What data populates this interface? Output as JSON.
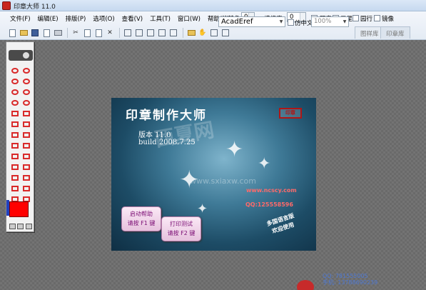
{
  "window": {
    "title": "印章大师 11.0"
  },
  "menu": [
    "文件(F)",
    "编辑(E)",
    "排版(P)",
    "选项(O)",
    "查看(V)",
    "工具(T)",
    "窗口(W)",
    "帮助(H)"
  ],
  "controls": {
    "rotation_label": "旋转角:",
    "rotation_value": "0",
    "stretch_label": "横缩度:",
    "stretch_value": "0",
    "yang_label": "阳章",
    "five_star_label": "五星",
    "circle_label": "园行",
    "mirror_label": "镜像",
    "font_value": "AcadEref",
    "fangzhong_label": "仿中文",
    "zoom_value": "100%",
    "tab_template": "图样库",
    "tab_stamp": "印章库"
  },
  "splash": {
    "title": "印章制作大师",
    "seal_text": "印章",
    "version": "版本 11.0",
    "build": "build 2008.7.25",
    "watermark_big": "西夏网",
    "watermark_url": "www.sxiaxw.com",
    "website": "www.ncscy.com",
    "qq": "QQ:125558596",
    "btn_help_line1": "启动帮助",
    "btn_help_line2": "请按 F1 键",
    "btn_print_line1": "打印测试",
    "btn_print_line2": "请按 F2 键",
    "note_line1": "多国语言版",
    "note_line2": "欢迎使用"
  },
  "contact": {
    "qq": "QQ: 781555005",
    "phone": "手机: 13788690239"
  },
  "colors": {
    "current_color": "#ff0000"
  }
}
